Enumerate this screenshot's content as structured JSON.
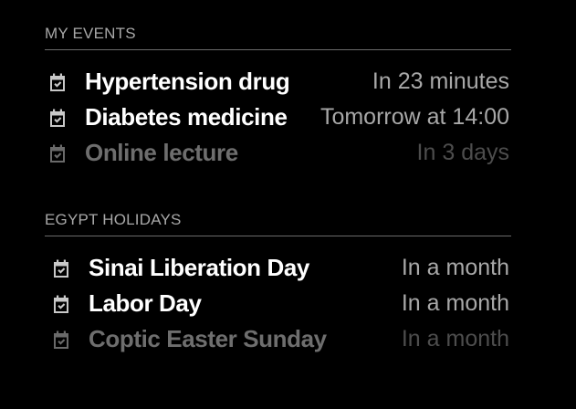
{
  "calendars": [
    {
      "header": "MY EVENTS",
      "events": [
        {
          "icon": "calendar-check-icon",
          "title": "Hypertension drug",
          "time": "In 23 minutes",
          "emphasis": "bright"
        },
        {
          "icon": "calendar-check-icon",
          "title": "Diabetes medicine",
          "time": "Tomorrow at 14:00",
          "emphasis": "bright"
        },
        {
          "icon": "calendar-check-icon",
          "title": "Online lecture",
          "time": "In 3 days",
          "emphasis": "dim"
        }
      ]
    },
    {
      "header": "EGYPT HOLIDAYS",
      "events": [
        {
          "icon": "calendar-check-icon",
          "title": "Sinai Liberation Day",
          "time": "In a month",
          "emphasis": "bright"
        },
        {
          "icon": "calendar-check-icon",
          "title": "Labor Day",
          "time": "In a month",
          "emphasis": "bright"
        },
        {
          "icon": "calendar-check-icon",
          "title": "Coptic Easter Sunday",
          "time": "In a month",
          "emphasis": "dim"
        }
      ]
    }
  ],
  "colors": {
    "background": "#000000",
    "title_bright": "#ffffff",
    "text_secondary": "#a8a8a8",
    "text_dim": "#6e6e6e",
    "divider": "#6b6b6b"
  }
}
